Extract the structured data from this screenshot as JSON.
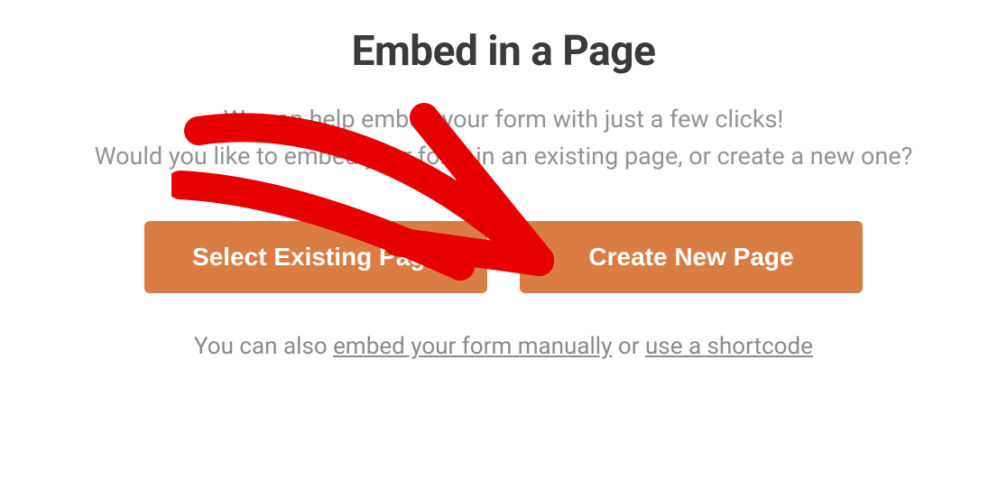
{
  "title": "Embed in a Page",
  "description": {
    "line1": "We can help embed your form with just a few clicks!",
    "line2_prefix": "Would you like to embed your form in an existing page, or create a new one?"
  },
  "buttons": {
    "select_existing": "Select Existing Page",
    "create_new": "Create New Page"
  },
  "footer": {
    "prefix": "You can also ",
    "link_manual": "embed your form manually",
    "middle": " or ",
    "link_shortcode": "use a shortcode"
  }
}
